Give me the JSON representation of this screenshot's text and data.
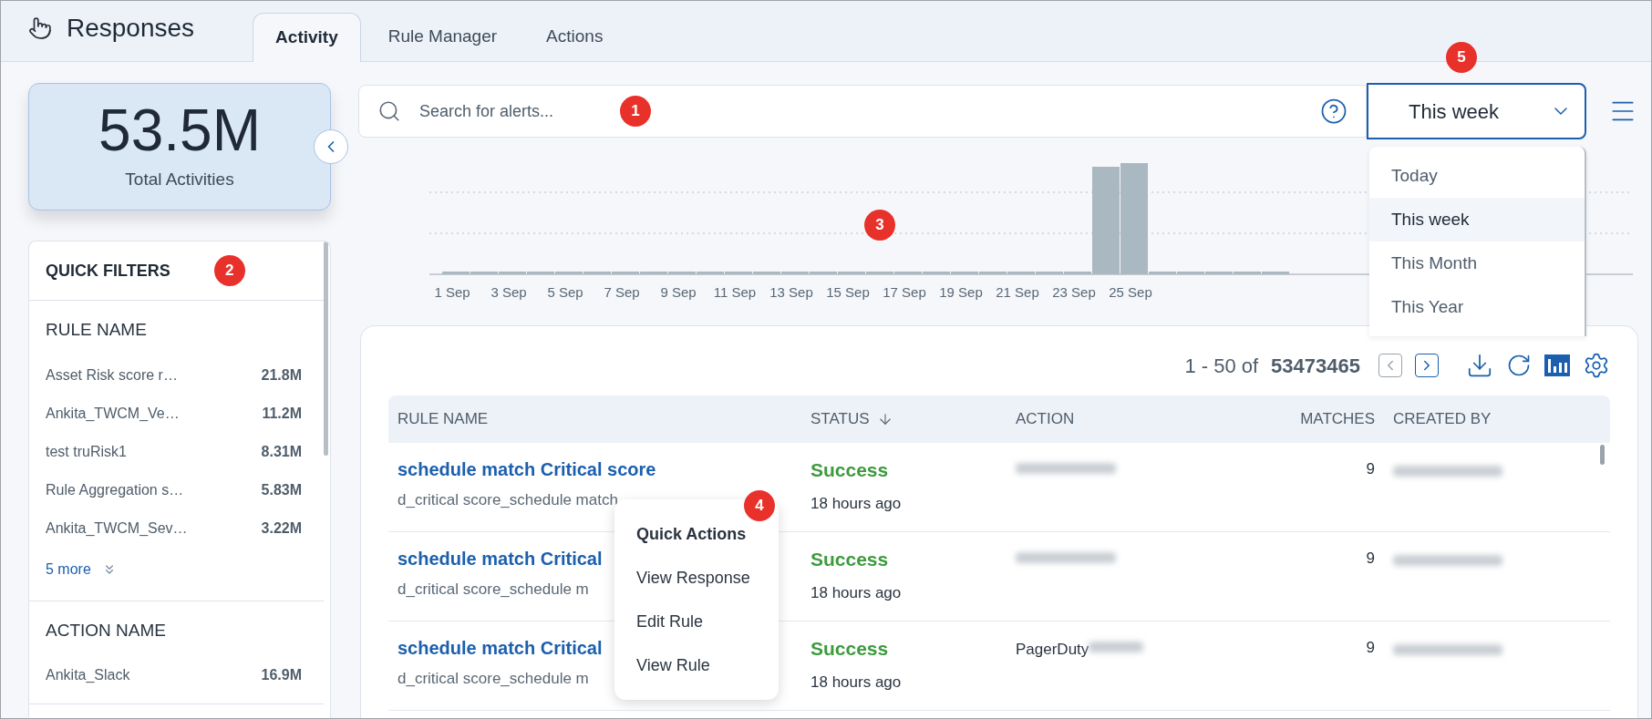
{
  "header": {
    "title": "Responses"
  },
  "tabs": [
    {
      "label": "Activity",
      "selected": true
    },
    {
      "label": "Rule Manager",
      "selected": false
    },
    {
      "label": "Actions",
      "selected": false
    }
  ],
  "summary": {
    "value": "53.5M",
    "label": "Total Activities"
  },
  "quick_filters": {
    "title": "QUICK FILTERS",
    "callout": "2",
    "groups": [
      {
        "title": "RULE NAME",
        "items": [
          {
            "name": "Asset Risk score r…",
            "count": "21.8M"
          },
          {
            "name": "Ankita_TWCM_Ve…",
            "count": "11.2M"
          },
          {
            "name": "test truRisk1",
            "count": "8.31M"
          },
          {
            "name": "Rule Aggregation s…",
            "count": "5.83M"
          },
          {
            "name": "Ankita_TWCM_Sev…",
            "count": "3.22M"
          }
        ],
        "more": "5 more"
      },
      {
        "title": "ACTION NAME",
        "items": [
          {
            "name": "Ankita_Slack",
            "count": "16.9M"
          }
        ]
      }
    ]
  },
  "search": {
    "placeholder": "Search for alerts...",
    "callout": "1"
  },
  "period": {
    "value": "This week",
    "callout": "5",
    "expanded": true,
    "options": [
      {
        "label": "Today",
        "selected": false
      },
      {
        "label": "This week",
        "selected": true
      },
      {
        "label": "This Month",
        "selected": false
      },
      {
        "label": "This Year",
        "selected": false
      }
    ]
  },
  "chart": {
    "callout": "3",
    "x_labels": [
      "1 Sep",
      "3 Sep",
      "5 Sep",
      "7 Sep",
      "9 Sep",
      "11 Sep",
      "13 Sep",
      "15 Sep",
      "17 Sep",
      "19 Sep",
      "21 Sep",
      "23 Sep",
      "25 Sep"
    ]
  },
  "table": {
    "pagination": {
      "range": "1 - 50 of",
      "total": "53473465"
    },
    "columns": [
      {
        "label": "RULE NAME",
        "sorted": false
      },
      {
        "label": "STATUS",
        "sorted": true
      },
      {
        "label": "ACTION",
        "sorted": false
      },
      {
        "label": "MATCHES",
        "sorted": false
      },
      {
        "label": "CREATED BY",
        "sorted": false
      }
    ],
    "rows": [
      {
        "rule": "schedule match Critical score",
        "subtitle": "d_critical score_schedule match",
        "status": "Success",
        "time": "18 hours ago",
        "action_blurred": true,
        "matches": "9",
        "created_by_blurred": true
      },
      {
        "rule": "schedule match Critical",
        "subtitle": "d_critical score_schedule m",
        "status": "Success",
        "time": "18 hours ago",
        "action_blurred": true,
        "matches": "9",
        "created_by_blurred": true
      },
      {
        "rule": "schedule match Critical",
        "subtitle": "d_critical score_schedule m",
        "status": "Success",
        "time": "18 hours ago",
        "action": "PagerDuty",
        "action_blurred": true,
        "matches": "9",
        "created_by_blurred": true
      }
    ]
  },
  "quick_actions": {
    "title": "Quick Actions",
    "callout": "4",
    "items": [
      "View Response",
      "Edit Rule",
      "View Rule"
    ]
  }
}
